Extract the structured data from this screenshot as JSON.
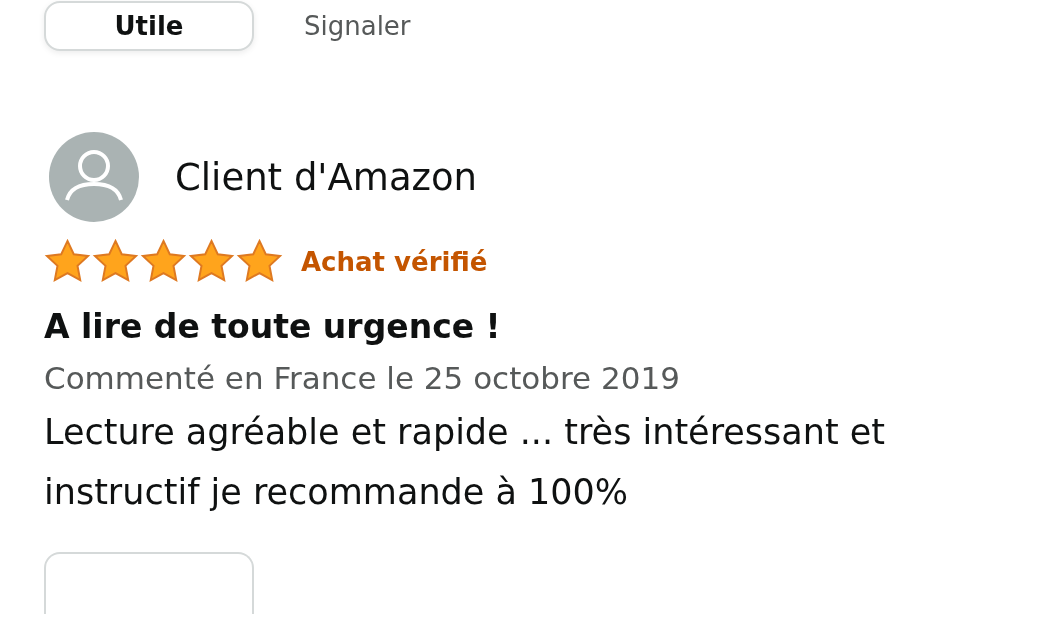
{
  "top_actions": {
    "helpful_button": "Utile",
    "report_link": "Signaler"
  },
  "review": {
    "author": "Client d'Amazon",
    "stars": 5,
    "badge": "Achat vérifié",
    "title": "A lire de toute urgence !",
    "meta": "Commenté en France le 25 octobre 2019",
    "body": "Lecture agréable et rapide ... très intéressant et instructif je recommande à 100%"
  }
}
